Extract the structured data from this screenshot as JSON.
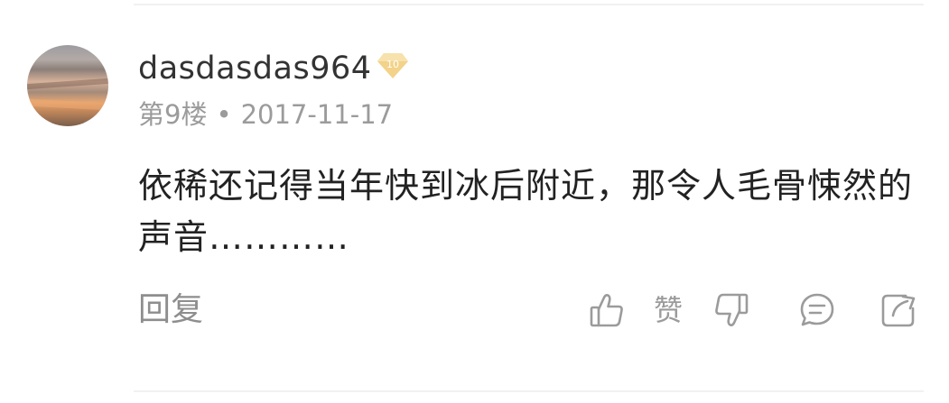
{
  "comment": {
    "username": "dasdasdas964",
    "level": "10",
    "floor": "第9楼",
    "separator": "•",
    "date": "2017-11-17",
    "text": "依稀还记得当年快到冰后附近，那令人毛骨悚然的声音…………"
  },
  "actions": {
    "reply_label": "回复",
    "like_label": "赞",
    "icons": [
      "thumbs-up-icon",
      "thumbs-down-icon",
      "comment-icon",
      "share-icon"
    ]
  },
  "colors": {
    "username": "#333333",
    "meta": "#9b9b9b",
    "content": "#222222",
    "badge": "#f3d28a"
  }
}
